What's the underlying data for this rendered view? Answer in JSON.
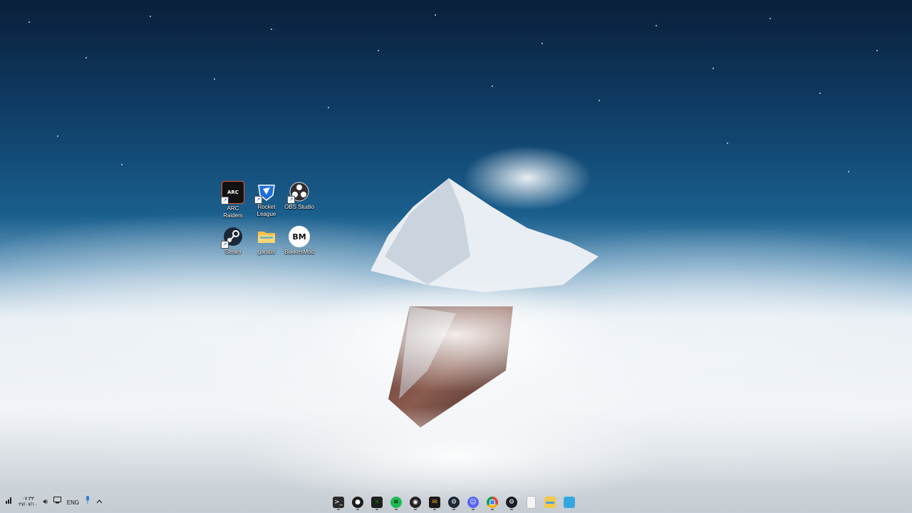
{
  "desktop": {
    "icons": [
      {
        "label": "ARC Raiders",
        "icon": "arc-raiders-icon",
        "badge": "ARC"
      },
      {
        "label": "Rocket League",
        "icon": "rocket-league-icon"
      },
      {
        "label": "OBS Studio",
        "icon": "obs-studio-icon"
      },
      {
        "label": "Steam",
        "icon": "steam-icon"
      },
      {
        "label": "garabs",
        "icon": "folder-icon"
      },
      {
        "label": "BakkesMod",
        "icon": "bakkesmod-icon",
        "badge": "BM"
      }
    ]
  },
  "taskbar": {
    "clock": {
      "time": "۰۷:۳۳",
      "date": "۲۷/۰۷/۱۰"
    },
    "language": "ENG",
    "tray_icons": [
      "network-icon",
      "volume-icon",
      "display-icon",
      "microphone-icon",
      "chevron-up-icon"
    ],
    "apps": [
      {
        "icon": "terminal-icon",
        "color": "#2b2b2b"
      },
      {
        "icon": "steam-notification-icon",
        "color": "#1b1b1b"
      },
      {
        "icon": "xbox-icon",
        "color": "#107c10"
      },
      {
        "icon": "spotify-icon",
        "color": "#1db954"
      },
      {
        "icon": "arc-raiders-icon",
        "color": "#222222"
      },
      {
        "icon": "mail-icon",
        "color": "#1a1a1a"
      },
      {
        "icon": "steam-icon",
        "color": "#1b2838"
      },
      {
        "icon": "discord-icon",
        "color": "#5865f2"
      },
      {
        "icon": "chrome-icon",
        "color": "#db4437"
      },
      {
        "icon": "steam-client-icon",
        "color": "#171a21"
      },
      {
        "icon": "notepad-icon",
        "color": "#f5f5f5"
      },
      {
        "icon": "file-explorer-icon",
        "color": "#f2c94c"
      },
      {
        "icon": "store-icon",
        "color": "#35a7e0"
      }
    ]
  }
}
